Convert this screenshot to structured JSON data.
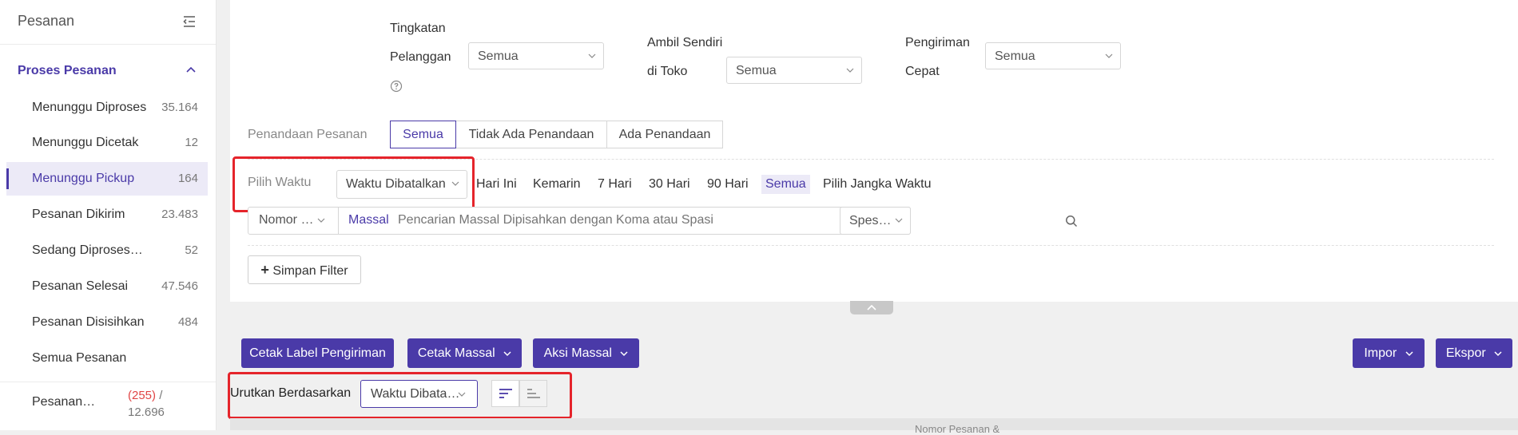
{
  "sidebar": {
    "title": "Pesanan",
    "group_label": "Proses Pesanan",
    "items": [
      {
        "label": "Menunggu Diproses",
        "count": "35.164"
      },
      {
        "label": "Menunggu Dicetak",
        "count": "12"
      },
      {
        "label": "Menunggu Pickup",
        "count": "164"
      },
      {
        "label": "Pesanan Dikirim",
        "count": "23.483"
      },
      {
        "label": "Sedang Diproses…",
        "count": "52"
      },
      {
        "label": "Pesanan Selesai",
        "count": "47.546"
      },
      {
        "label": "Pesanan Disisihkan",
        "count": "484"
      },
      {
        "label": "Semua Pesanan",
        "count": ""
      }
    ],
    "last_item": {
      "label": "Pesanan…",
      "count_red": "(255)",
      "count_sep": " /",
      "count_total": "12.696"
    }
  },
  "filters": {
    "tingkatan_label_1": "Tingkatan",
    "tingkatan_label_2": "Pelanggan",
    "tingkatan_value": "Semua",
    "ambil_label_1": "Ambil Sendiri",
    "ambil_label_2": "di Toko",
    "ambil_value": "Semua",
    "pengiriman_label_1": "Pengiriman",
    "pengiriman_label_2": "Cepat",
    "pengiriman_value": "Semua",
    "penandaan_label": "Penandaan Pesanan",
    "penandaan_options": [
      "Semua",
      "Tidak Ada Penandaan",
      "Ada Penandaan"
    ],
    "pilih_waktu_label": "Pilih Waktu",
    "waktu_value": "Waktu Dibatalkan",
    "quick_ranges": [
      "Hari Ini",
      "Kemarin",
      "7 Hari",
      "30 Hari",
      "90 Hari",
      "Semua",
      "Pilih Jangka Waktu"
    ],
    "quick_selected": "Semua",
    "search_field_value": "Nomor …",
    "search_mode": "Massal",
    "search_placeholder": "Pencarian Massal Dipisahkan dengan Koma atau Spasi",
    "spec_value": "Spes…",
    "save_filter_label": "Simpan Filter"
  },
  "toolbar": {
    "cetak_label": "Cetak Label Pengiriman",
    "cetak_massal": "Cetak Massal",
    "aksi_massal": "Aksi Massal",
    "impor": "Impor",
    "ekspor": "Ekspor"
  },
  "sort": {
    "label": "Urutkan Berdasarkan",
    "value": "Waktu Dibata…"
  },
  "table": {
    "first_header_partial": "Nomor Pesanan &"
  },
  "colors": {
    "accent": "#4a3aa8",
    "highlight": "#e5242b"
  }
}
